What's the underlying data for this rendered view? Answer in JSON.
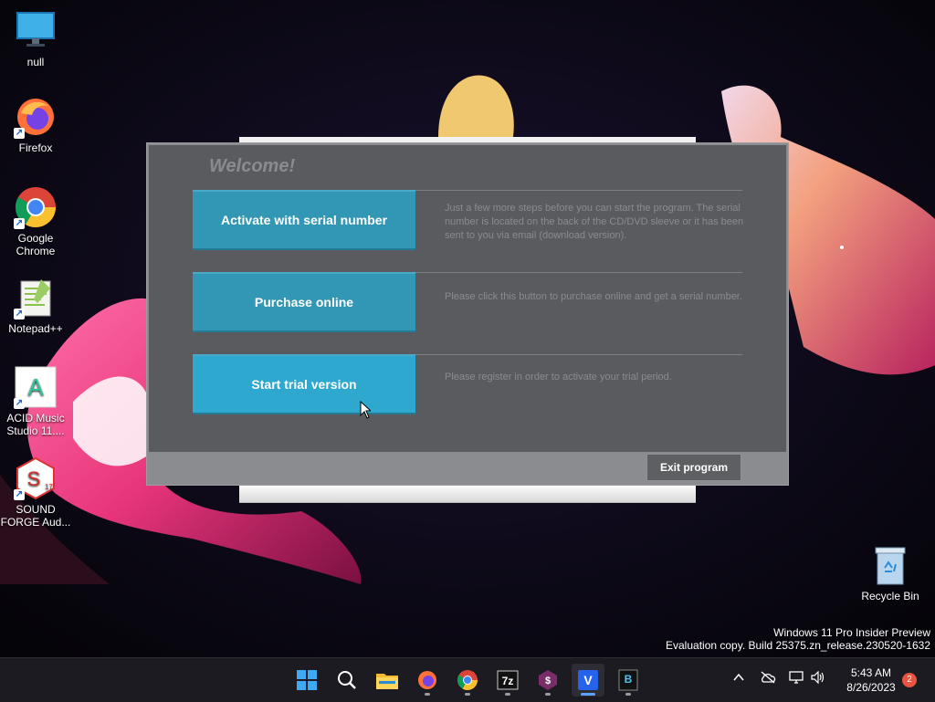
{
  "desktop": {
    "icons": [
      {
        "label": "null",
        "icon": "monitor-icon"
      },
      {
        "label": "Firefox",
        "icon": "firefox-icon"
      },
      {
        "label": "Google Chrome",
        "icon": "chrome-icon"
      },
      {
        "label": "Notepad++",
        "icon": "notepadpp-icon"
      },
      {
        "label": "ACID Music Studio 11....",
        "icon": "acid-icon"
      },
      {
        "label": "SOUND FORGE Aud...",
        "icon": "soundforge-icon"
      }
    ],
    "recycle_bin_label": "Recycle Bin",
    "watermark_line1": "Windows 11 Pro Insider Preview",
    "watermark_line2": "Evaluation copy. Build 25375.zn_release.230520-1632"
  },
  "dialog": {
    "welcome": "Welcome!",
    "options": [
      {
        "label": "Activate with serial number",
        "description": "Just a few more steps before you can start the program. The serial number is located on the back of the CD/DVD sleeve or it has been sent to you via email (download version)."
      },
      {
        "label": "Purchase online",
        "description": "Please click this button to purchase online and get a serial number."
      },
      {
        "label": "Start trial version",
        "description": "Please register in order to activate your trial period."
      }
    ],
    "exit_label": "Exit program"
  },
  "taskbar": {
    "items": [
      "windows-start-icon",
      "search-icon",
      "file-explorer-icon",
      "firefox-icon",
      "chrome-icon",
      "7zip-icon",
      "soundforge-icon",
      "vegas-icon",
      "boris-icon"
    ],
    "clock_time": "5:43 AM",
    "clock_date": "8/26/2023",
    "notification_count": "2"
  },
  "colors": {
    "accent_button": "#3297b5",
    "dialog_bg": "#5a5b5f"
  }
}
